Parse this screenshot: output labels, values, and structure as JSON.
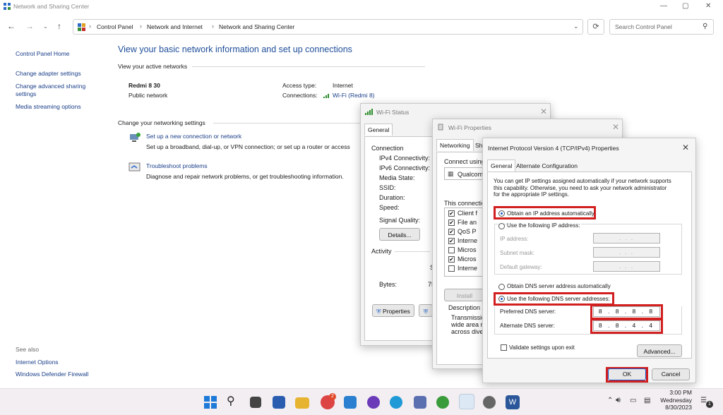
{
  "window": {
    "title": "Network and Sharing Center"
  },
  "nav": {
    "breadcrumbs": [
      "Control Panel",
      "Network and Internet",
      "Network and Sharing Center"
    ],
    "search_placeholder": "Search Control Panel"
  },
  "sidebar": {
    "items": [
      {
        "label": "Control Panel Home"
      },
      {
        "label": "Change adapter settings"
      },
      {
        "label": "Change advanced sharing"
      },
      {
        "label": "settings"
      },
      {
        "label": "Media streaming options"
      }
    ],
    "see_also_label": "See also",
    "see_also": [
      {
        "label": "Internet Options"
      },
      {
        "label": "Windows Defender Firewall"
      }
    ]
  },
  "main": {
    "heading": "View your basic network information and set up connections",
    "active_networks_label": "View your active networks",
    "network_name": "Redmi 8 30",
    "network_type": "Public network",
    "access_type_label": "Access type:",
    "access_type_value": "Internet",
    "connections_label": "Connections:",
    "connections_value": "Wi-Fi (Redmi 8)",
    "change_settings_label": "Change your networking settings",
    "tasks": [
      {
        "title": "Set up a new connection or network",
        "desc": "Set up a broadband, dial-up, or VPN connection; or set up a router or access"
      },
      {
        "title": "Troubleshoot problems",
        "desc": "Diagnose and repair network problems, or get troubleshooting information."
      }
    ]
  },
  "wifi_status": {
    "title": "Wi-Fi Status",
    "tab": "General",
    "connection_label": "Connection",
    "rows": [
      "IPv4 Connectivity:",
      "IPv6 Connectivity:",
      "Media State:",
      "SSID:",
      "Duration:",
      "Speed:"
    ],
    "signal_quality": "Signal Quality:",
    "details_button": "Details...",
    "activity_label": "Activity",
    "s_glyph": "S",
    "bytes_label": "Bytes:",
    "bytes_value": "75",
    "properties_button": "Properties"
  },
  "wifi_props": {
    "title": "Wi-Fi Properties",
    "tab_networking": "Networking",
    "tab_sharing": "Sh",
    "connect_using": "Connect using:",
    "adapter": "Qualcom",
    "this_connection": "This connection",
    "items": [
      {
        "label": "Client f",
        "checked": "✔"
      },
      {
        "label": "File an",
        "checked": "✔"
      },
      {
        "label": "QoS P",
        "checked": "✔"
      },
      {
        "label": "Interne",
        "checked": "✔"
      },
      {
        "label": "Micros",
        "checked": ""
      },
      {
        "label": "Micros",
        "checked": "✔"
      },
      {
        "label": "Interne",
        "checked": ""
      }
    ],
    "install_button": "Install",
    "description_label": "Description",
    "description_lines": [
      "Transmission",
      "wide area ne",
      "across divers"
    ]
  },
  "ipv4": {
    "title": "Internet Protocol Version 4 (TCP/IPv4) Properties",
    "tab_general": "General",
    "tab_alternate": "Alternate Configuration",
    "intro_lines": [
      "You can get IP settings assigned automatically if your network supports",
      "this capability. Otherwise, you need to ask your network administrator",
      "for the appropriate IP settings."
    ],
    "obtain_ip_auto": "Obtain an IP address automatically",
    "use_following_ip": "Use the following IP address:",
    "ip_address_label": "IP address:",
    "subnet_mask_label": "Subnet mask:",
    "default_gateway_label": "Default gateway:",
    "empty_ip": ".      .      .",
    "obtain_dns_auto": "Obtain DNS server address automatically",
    "use_following_dns": "Use the following DNS server addresses:",
    "preferred_dns_label": "Preferred DNS server:",
    "preferred_dns_value": "8 . 8 . 8 . 8",
    "alternate_dns_label": "Alternate DNS server:",
    "alternate_dns_value": "8 . 8 . 4 . 4",
    "validate_label": "Validate settings upon exit",
    "advanced_button": "Advanced...",
    "ok_button": "OK",
    "cancel_button": "Cancel"
  },
  "taskbar": {
    "time": "3:00 PM",
    "day": "Wednesday",
    "date": "8/30/2023",
    "badge_chrome": "2",
    "notif_count": "1"
  },
  "colors": {
    "link": "#1a3e88",
    "heading": "#1f4e9a",
    "highlight": "#d21f1f"
  }
}
